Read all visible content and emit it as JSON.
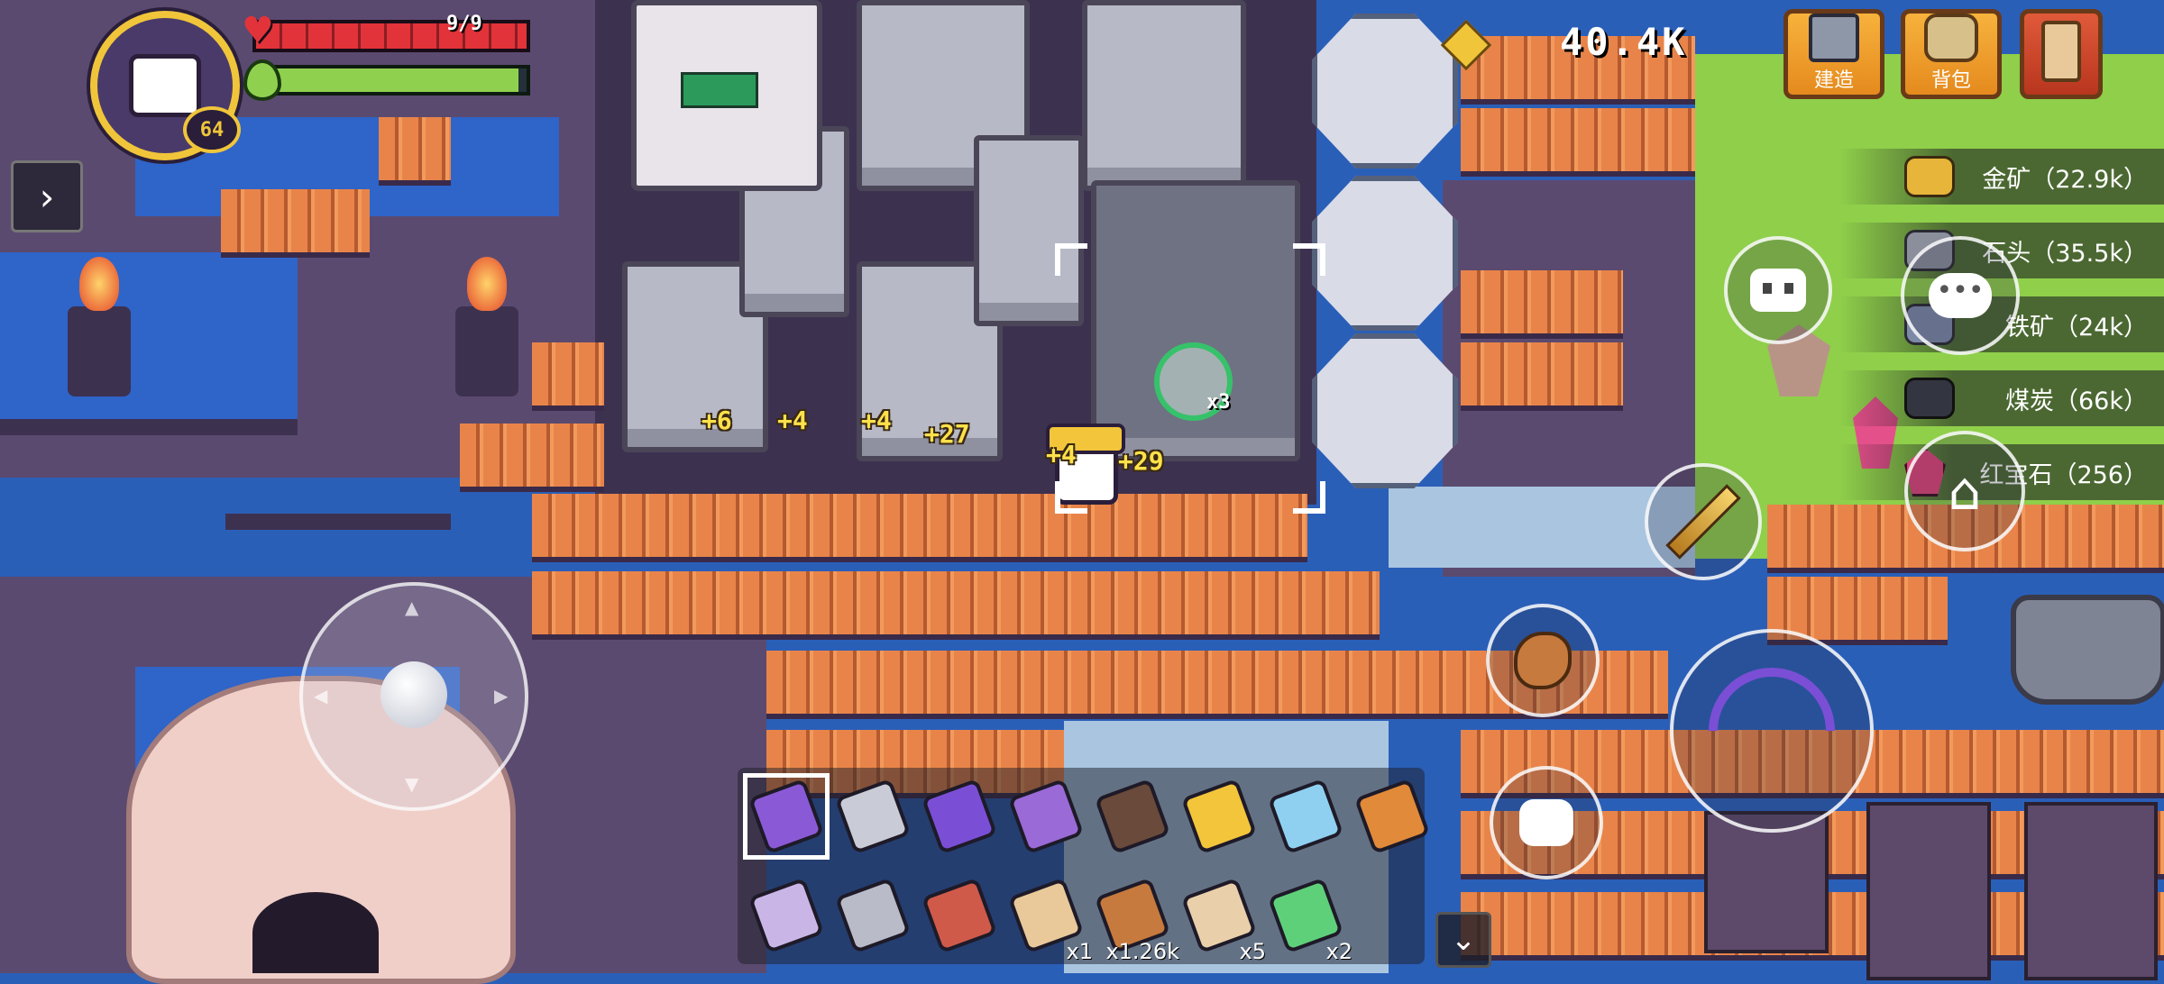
{
  "player": {
    "level": "64",
    "health_text": "9/9",
    "health_fraction": 1.0,
    "energy_fraction": 0.97
  },
  "currency": {
    "amount": "40.4K",
    "icon": "gold-coin-icon"
  },
  "top_buttons": [
    {
      "label": "建造",
      "icon": "build-hammer-icon"
    },
    {
      "label": "背包",
      "icon": "backpack-icon"
    },
    {
      "label": "",
      "icon": "scroll-quest-icon"
    }
  ],
  "resources": [
    {
      "label": "金矿（22.9k）",
      "icon": "gold-ore-icon",
      "color": "#e6b53a"
    },
    {
      "label": "石头（35.5k）",
      "icon": "stone-icon",
      "color": "#8b8f9c"
    },
    {
      "label": "铁矿（24k）",
      "icon": "iron-ore-icon",
      "color": "#7c8aa8"
    },
    {
      "label": "煤炭（66k）",
      "icon": "coal-icon",
      "color": "#333641"
    },
    {
      "label": "红宝石（256）",
      "icon": "ruby-icon",
      "color": "#e0457a"
    }
  ],
  "gains": [
    "+6",
    "+4",
    "+4",
    "+27",
    "+4",
    "+29"
  ],
  "marker_count": "x3",
  "hotbar": [
    {
      "icon": "pickaxe-icon",
      "count": "",
      "selected": true
    },
    {
      "icon": "shovel-icon",
      "count": ""
    },
    {
      "icon": "crossbow-icon",
      "count": ""
    },
    {
      "icon": "bow-icon",
      "count": ""
    },
    {
      "icon": "rod-icon",
      "count": ""
    },
    {
      "icon": "sword-icon",
      "count": ""
    },
    {
      "icon": "ice-staff-icon",
      "count": ""
    },
    {
      "icon": "spear-icon",
      "count": ""
    },
    {
      "icon": "skull-staff-icon",
      "count": ""
    },
    {
      "icon": "hammer-icon",
      "count": ""
    },
    {
      "icon": "fishing-rod-icon",
      "count": ""
    },
    {
      "icon": "scroll-icon",
      "count": "x1"
    },
    {
      "icon": "meat-icon",
      "count": "x1.26k"
    },
    {
      "icon": "map-scroll-icon",
      "count": "x5"
    },
    {
      "icon": "battery-icon",
      "count": "x2"
    }
  ],
  "actions": {
    "bot": "robot-icon",
    "chat": "chat-bubble-icon",
    "weapon_swap": "golden-sword-icon",
    "food": "meat-icon",
    "roll": "dodge-roll-icon",
    "attack": "crossbow-attack-icon",
    "home": "home-cancel-icon"
  },
  "colors": {
    "accent": "#f7b23c",
    "health": "#e2333a",
    "energy": "#8fd14f"
  }
}
